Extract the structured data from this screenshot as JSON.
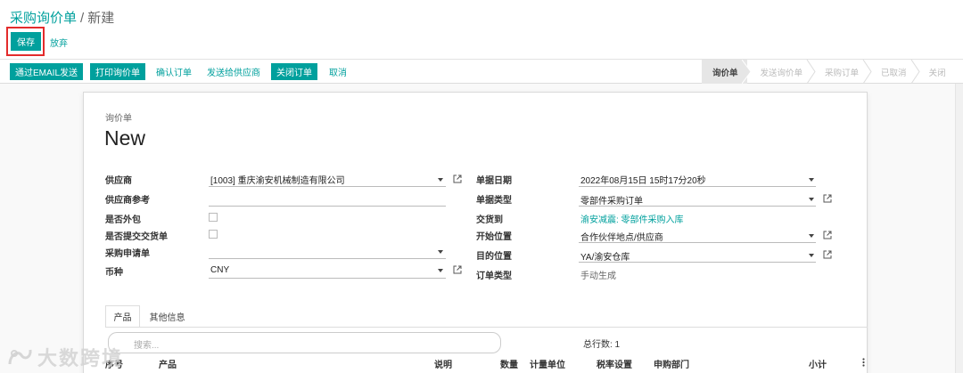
{
  "breadcrumb": {
    "parent": "采购询价单",
    "separator": "/",
    "current": "新建"
  },
  "actions": {
    "save": "保存",
    "discard": "放弃"
  },
  "statusbar": {
    "buttons": [
      {
        "label": "通过EMAIL发送",
        "style": "primary"
      },
      {
        "label": "打印询价单",
        "style": "primary"
      },
      {
        "label": "确认订单",
        "style": "link"
      },
      {
        "label": "发送给供应商",
        "style": "link"
      },
      {
        "label": "关闭订单",
        "style": "primary"
      },
      {
        "label": "取消",
        "style": "link"
      }
    ],
    "stages": [
      "询价单",
      "发送询价单",
      "采购订单",
      "已取消",
      "关闭"
    ],
    "active_stage": "询价单"
  },
  "form": {
    "doc_type": "询价单",
    "doc_name": "New",
    "left": {
      "vendor": {
        "label": "供应商",
        "value": "[1003] 重庆渝安机械制造有限公司"
      },
      "vendor_ref": {
        "label": "供应商参考",
        "value": ""
      },
      "outsourced": {
        "label": "是否外包",
        "checked": false
      },
      "submit_delivery": {
        "label": "是否提交交货单",
        "checked": false
      },
      "purchase_request": {
        "label": "采购申请单",
        "value": ""
      },
      "currency": {
        "label": "币种",
        "value": "CNY"
      }
    },
    "right": {
      "doc_date": {
        "label": "单据日期",
        "value": "2022年08月15日 15时17分20秒"
      },
      "doc_type": {
        "label": "单据类型",
        "value": "零部件采购订单"
      },
      "deliver_to": {
        "label": "交货到",
        "value": "渝安减震: 零部件采购入库"
      },
      "source_location": {
        "label": "开始位置",
        "value": "合作伙伴地点/供应商"
      },
      "dest_location": {
        "label": "目的位置",
        "value": "YA/渝安仓库"
      },
      "order_type": {
        "label": "订单类型",
        "value": "手动生成"
      }
    }
  },
  "tabs": [
    "产品",
    "其他信息"
  ],
  "lines": {
    "search_placeholder": "搜索...",
    "row_count": "总行数: 1",
    "columns": [
      "序号",
      "产品",
      "说明",
      "数量",
      "计量单位",
      "税率设置",
      "申购部门",
      "小计"
    ]
  },
  "watermark": "大数跨境",
  "colors": {
    "primary": "#00a09d",
    "highlight": "#e32b2b"
  }
}
